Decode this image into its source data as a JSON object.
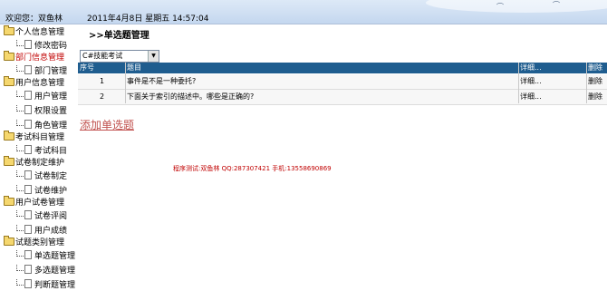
{
  "header": {
    "welcome": "欢迎您：双鱼林",
    "datetime": "2011年4月8日  星期五  14:57:04"
  },
  "breadcrumb": ">>单选题管理",
  "filter": {
    "selected": "C#技能考试"
  },
  "table": {
    "columns": [
      "序号",
      "题目",
      "详细...",
      "删除"
    ],
    "rows": [
      {
        "no": "1",
        "question": "事件是不是一种委托?",
        "detail": "详细...",
        "delete": "删除"
      },
      {
        "no": "2",
        "question": "下面关于索引的描述中。哪些是正确的?",
        "detail": "详细...",
        "delete": "删除"
      }
    ]
  },
  "add_link": "添加单选题",
  "footnote": "程序测试:双鱼林 QQ:287307421 手机:13558690869",
  "sidebar": {
    "groups": [
      {
        "label": "个人信息管理",
        "items": [
          "修改密码"
        ]
      },
      {
        "label": "部门信息管理",
        "items": [
          "部门管理"
        ],
        "active": true
      },
      {
        "label": "用户信息管理",
        "items": [
          "用户管理",
          "权限设置",
          "角色管理"
        ]
      },
      {
        "label": "考试科目管理",
        "items": [
          "考试科目"
        ]
      },
      {
        "label": "试卷制定维护",
        "items": [
          "试卷制定",
          "试卷维护"
        ]
      },
      {
        "label": "用户试卷管理",
        "items": [
          "试卷评阅",
          "用户成绩"
        ]
      },
      {
        "label": "试题类别管理",
        "items": [
          "单选题管理",
          "多选题管理",
          "判断题管理"
        ]
      }
    ]
  },
  "colors": {
    "header_bg": "#1f5d8f",
    "active_text": "#c00000",
    "link": "#c0504d"
  }
}
